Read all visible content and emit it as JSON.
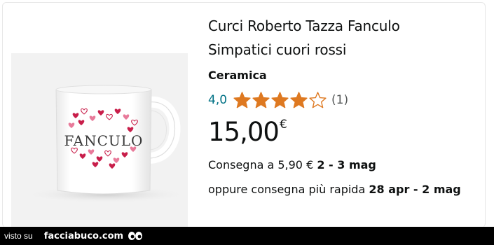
{
  "product": {
    "title_line1": "Curci Roberto Tazza Fanculo",
    "title_line2": "Simpatici cuori rossi",
    "material": "Ceramica",
    "rating_value": "4,0",
    "rating_stars": 4,
    "rating_max": 5,
    "rating_count": "(1)",
    "price_main": "15,00",
    "price_currency": "€",
    "delivery_prefix": "Consegna a 5,90 € ",
    "delivery_date": "2 - 3 mag",
    "fast_prefix": "oppure consegna più rapida ",
    "fast_date": "28 apr - 2 mag",
    "mug_text": "FANCULO"
  },
  "colors": {
    "star": "#de7921",
    "link": "#007185",
    "heart_red": "#c81e4a",
    "heart_pink": "#e87a9a"
  },
  "footer": {
    "visto_su": "visto su",
    "site": "facciabuco.com"
  }
}
